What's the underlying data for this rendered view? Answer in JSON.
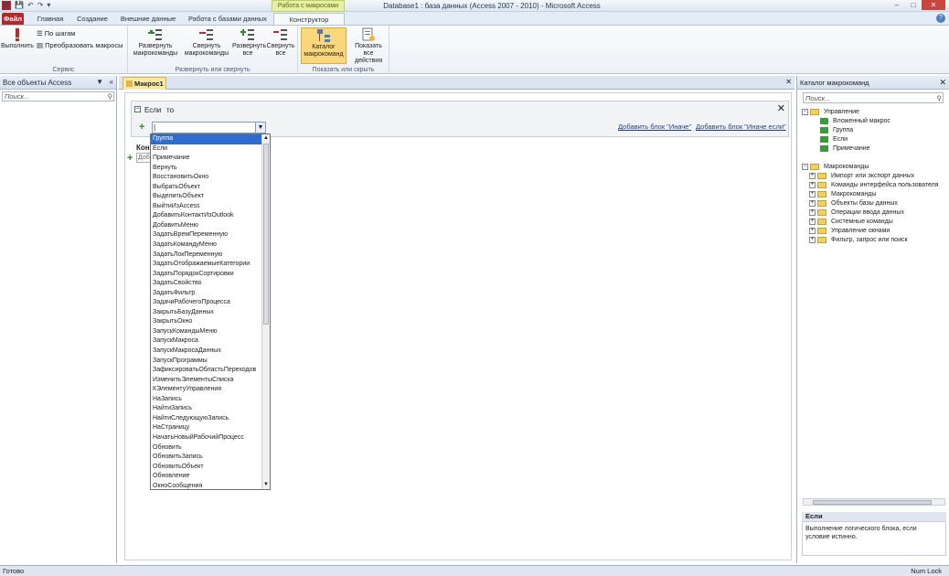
{
  "window": {
    "title": "Database1 : база данных (Access 2007 - 2010)  -  Microsoft Access",
    "context_tab_group": "Работа с макросами"
  },
  "ribbon_tabs": [
    "Файл",
    "Главная",
    "Создание",
    "Внешние данные",
    "Работа с базами данных",
    "Конструктор"
  ],
  "ribbon": {
    "service": {
      "label": "Сервис",
      "run": "Выполнить",
      "step": "По шагам",
      "convert": "Преобразовать макросы"
    },
    "expand": {
      "label": "Развернуть или свернуть",
      "expand_actions": "Развернуть макрокоманды",
      "collapse_actions": "Свернуть макрокоманды",
      "expand_all": "Развернуть все",
      "collapse_all": "Свернуть все"
    },
    "show": {
      "label": "Показать или скрыть",
      "catalog": "Каталог макрокоманд",
      "show_all": "Показать все действия"
    }
  },
  "nav_pane": {
    "title": "Все объекты Access",
    "search_placeholder": "Поиск..."
  },
  "document": {
    "tab": "Макрос1",
    "if_label": "Если",
    "then_label": "то",
    "add_else": "Добавить блок \"Иначе\"",
    "add_else_if": "Добавить блок \"Иначе если\"",
    "cond_label": "Конс",
    "add_action": "Доб"
  },
  "dropdown_items": [
    "Группа",
    "Если",
    "Примечание",
    "Вернуть",
    "ВосстановитьОкно",
    "ВыбратьОбъект",
    "ВыделитьОбъект",
    "ВыйтиИзAccess",
    "ДобавитьКонтактИзOutlook",
    "ДобавитьМеню",
    "ЗадатьВремПеременную",
    "ЗадатьКомандуМеню",
    "ЗадатьЛокПеременную",
    "ЗадатьОтображаемыеКатегории",
    "ЗадатьПорядокСортировки",
    "ЗадатьСвойство",
    "ЗадатьФильтр",
    "ЗадачиРабочегоПроцесса",
    "ЗакрытьБазуДанных",
    "ЗакрытьОкно",
    "ЗапускКомандыМеню",
    "ЗапускМакроса",
    "ЗапускМакросаДанных",
    "ЗапускПрограммы",
    "ЗафиксироватьОбластьПереходов",
    "ИзменитьЭлементыСписка",
    "КЭлементуУправления",
    "НаЗапись",
    "НайтиЗапись",
    "НайтиСледующуюЗапись",
    "НаСтраницу",
    "НачатьНовыйРабочийПроцесс",
    "Обновить",
    "ОбновитьЗапись",
    "ОбновитьОбъект",
    "Обновление",
    "ОкноСообщения"
  ],
  "catalog": {
    "title": "Каталог макрокоманд",
    "search_placeholder": "Поиск...",
    "control_folder": "Управление",
    "control_items": [
      "Вложенный макрос",
      "Группа",
      "Если",
      "Примечание"
    ],
    "actions_folder": "Макрокоманды",
    "action_groups": [
      "Импорт или экспорт данных",
      "Команды интерфейса пользователя",
      "Макрокоманды",
      "Объекты базы данных",
      "Операции ввода данных",
      "Системные команды",
      "Управление окнами",
      "Фильтр, запрос или поиск"
    ],
    "desc_title": "Если",
    "desc_text": "Выполнение логического блока, если условие истинно."
  },
  "status": {
    "left": "Готово",
    "right": "Num Lock"
  },
  "colors": {
    "file_tab": "#b3272d",
    "selection": "#2f6cd0",
    "highlight": "#fbd77c"
  }
}
